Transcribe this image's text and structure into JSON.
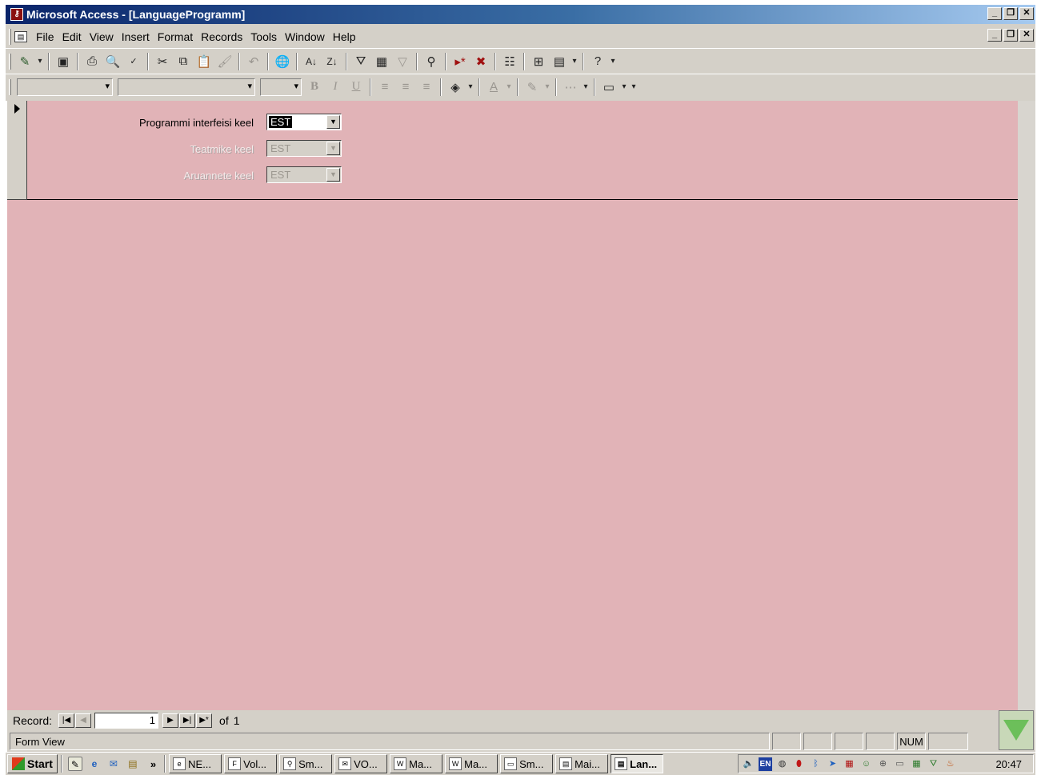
{
  "window": {
    "title": "Microsoft Access - [LanguageProgramm]",
    "icon": "access-key-icon"
  },
  "menubar": {
    "items": [
      "File",
      "Edit",
      "View",
      "Insert",
      "Format",
      "Records",
      "Tools",
      "Window",
      "Help"
    ]
  },
  "form": {
    "background": "#e1b3b7",
    "fields": [
      {
        "label": "Programmi interfeisi keel",
        "value": "EST",
        "enabled": true
      },
      {
        "label": "Teatmike keel",
        "value": "EST",
        "enabled": false
      },
      {
        "label": "Aruannete keel",
        "value": "EST",
        "enabled": false
      }
    ]
  },
  "navigation": {
    "record_label": "Record:",
    "current": "1",
    "of_label": "of",
    "total": "1"
  },
  "status": {
    "text": "Form View",
    "num": "NUM"
  },
  "taskbar": {
    "start_label": "Start",
    "chevron": "»",
    "buttons": [
      "NE...",
      "Vol...",
      "Sm...",
      "VO...",
      "Ma...",
      "Ma...",
      "Sm...",
      "Mai...",
      "Lan..."
    ],
    "tray_lang": "EN",
    "clock": "20:47"
  }
}
